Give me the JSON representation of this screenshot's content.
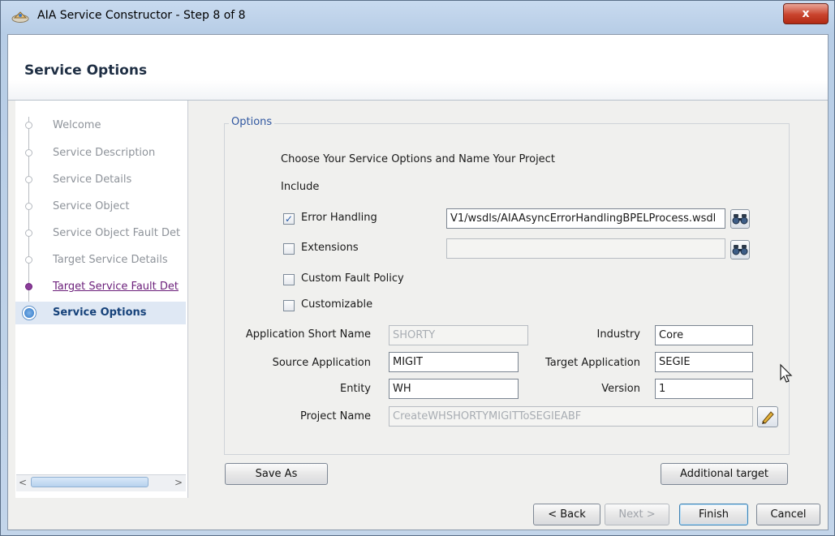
{
  "window": {
    "title": "AIA Service Constructor - Step 8 of 8",
    "close_glyph": "x"
  },
  "header": {
    "title": "Service Options"
  },
  "steps": [
    {
      "label": "Welcome",
      "state": "done"
    },
    {
      "label": "Service Description",
      "state": "done"
    },
    {
      "label": "Service Details",
      "state": "done"
    },
    {
      "label": "Service Object",
      "state": "done"
    },
    {
      "label": "Service Object Fault Det",
      "state": "done"
    },
    {
      "label": "Target Service Details",
      "state": "done"
    },
    {
      "label": "Target Service Fault Det",
      "state": "visited"
    },
    {
      "label": "Service Options",
      "state": "current"
    }
  ],
  "options": {
    "legend": "Options",
    "intro": "Choose Your Service Options and Name Your Project",
    "include_label": "Include",
    "error_handling": {
      "label": "Error Handling",
      "checked": true,
      "path": "V1/wsdls/AIAAsyncErrorHandlingBPELProcess.wsdl"
    },
    "extensions": {
      "label": "Extensions",
      "checked": false,
      "path": ""
    },
    "custom_fault_policy": {
      "label": "Custom Fault Policy",
      "checked": false
    },
    "customizable": {
      "label": "Customizable",
      "checked": false
    },
    "fields": {
      "app_short_name": {
        "label": "Application Short Name",
        "value": "SHORTY"
      },
      "industry": {
        "label": "Industry",
        "value": "Core"
      },
      "source_app": {
        "label": "Source Application",
        "value": "MIGIT"
      },
      "target_app": {
        "label": "Target Application",
        "value": "SEGIE"
      },
      "entity": {
        "label": "Entity",
        "value": "WH"
      },
      "version": {
        "label": "Version",
        "value": "1"
      },
      "project_name": {
        "label": "Project Name",
        "value": "CreateWHSHORTYMIGITToSEGIEABF"
      }
    }
  },
  "buttons": {
    "save_as": "Save As",
    "additional_target": "Additional target",
    "back": "< Back",
    "next": "Next >",
    "finish": "Finish",
    "cancel": "Cancel"
  },
  "colors": {
    "accent": "#3057a0",
    "visited_link": "#6b1f7a",
    "close": "#c9432d"
  }
}
